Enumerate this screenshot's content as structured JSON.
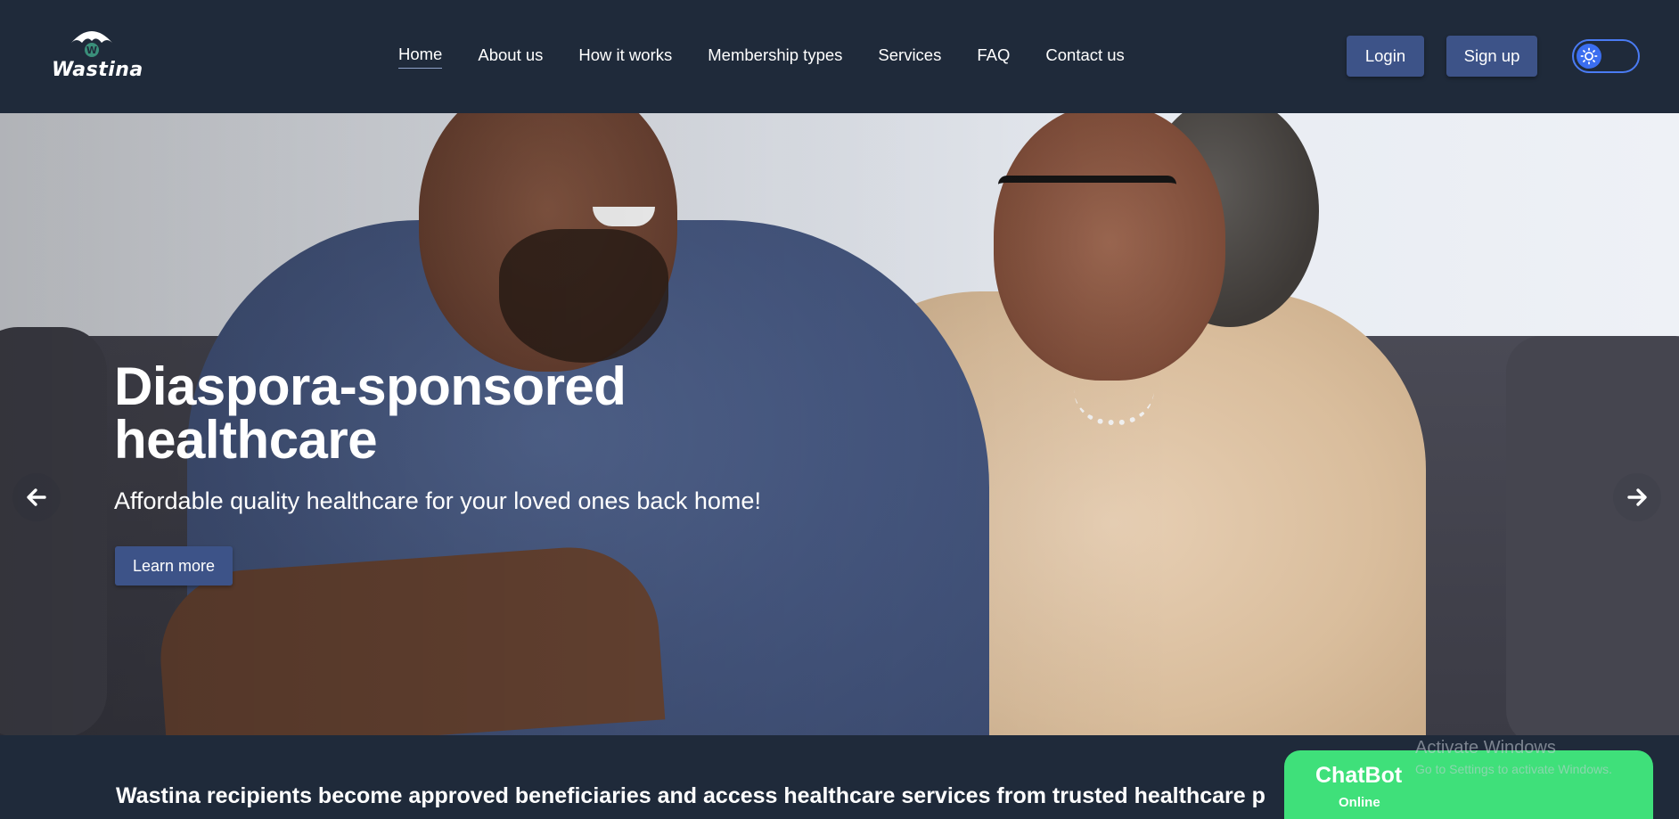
{
  "header": {
    "logo_text": "Wastina",
    "nav": [
      {
        "label": "Home",
        "active": true
      },
      {
        "label": "About us"
      },
      {
        "label": "How it works"
      },
      {
        "label": "Membership types"
      },
      {
        "label": "Services"
      },
      {
        "label": "FAQ"
      },
      {
        "label": "Contact us"
      }
    ],
    "login_label": "Login",
    "signup_label": "Sign up",
    "theme_toggle_icon": "sun-icon"
  },
  "hero": {
    "title": "Diaspora-sponsored healthcare",
    "subtitle": "Affordable quality healthcare for your loved ones back home!",
    "cta_label": "Learn more",
    "prev_icon": "arrow-left-icon",
    "next_icon": "arrow-right-icon"
  },
  "band": {
    "text": "Wastina recipients become approved beneficiaries and access healthcare services from trusted healthcare p"
  },
  "chatbot": {
    "title": "ChatBot",
    "status": "Online"
  },
  "watermark": {
    "line1": "Activate Windows",
    "line2": "Go to Settings to activate Windows."
  },
  "colors": {
    "header_bg": "#1f2a3a",
    "button_bg": "#3d5388",
    "chatbot_bg": "#3fe07a",
    "toggle_accent": "#3b6ef0"
  }
}
